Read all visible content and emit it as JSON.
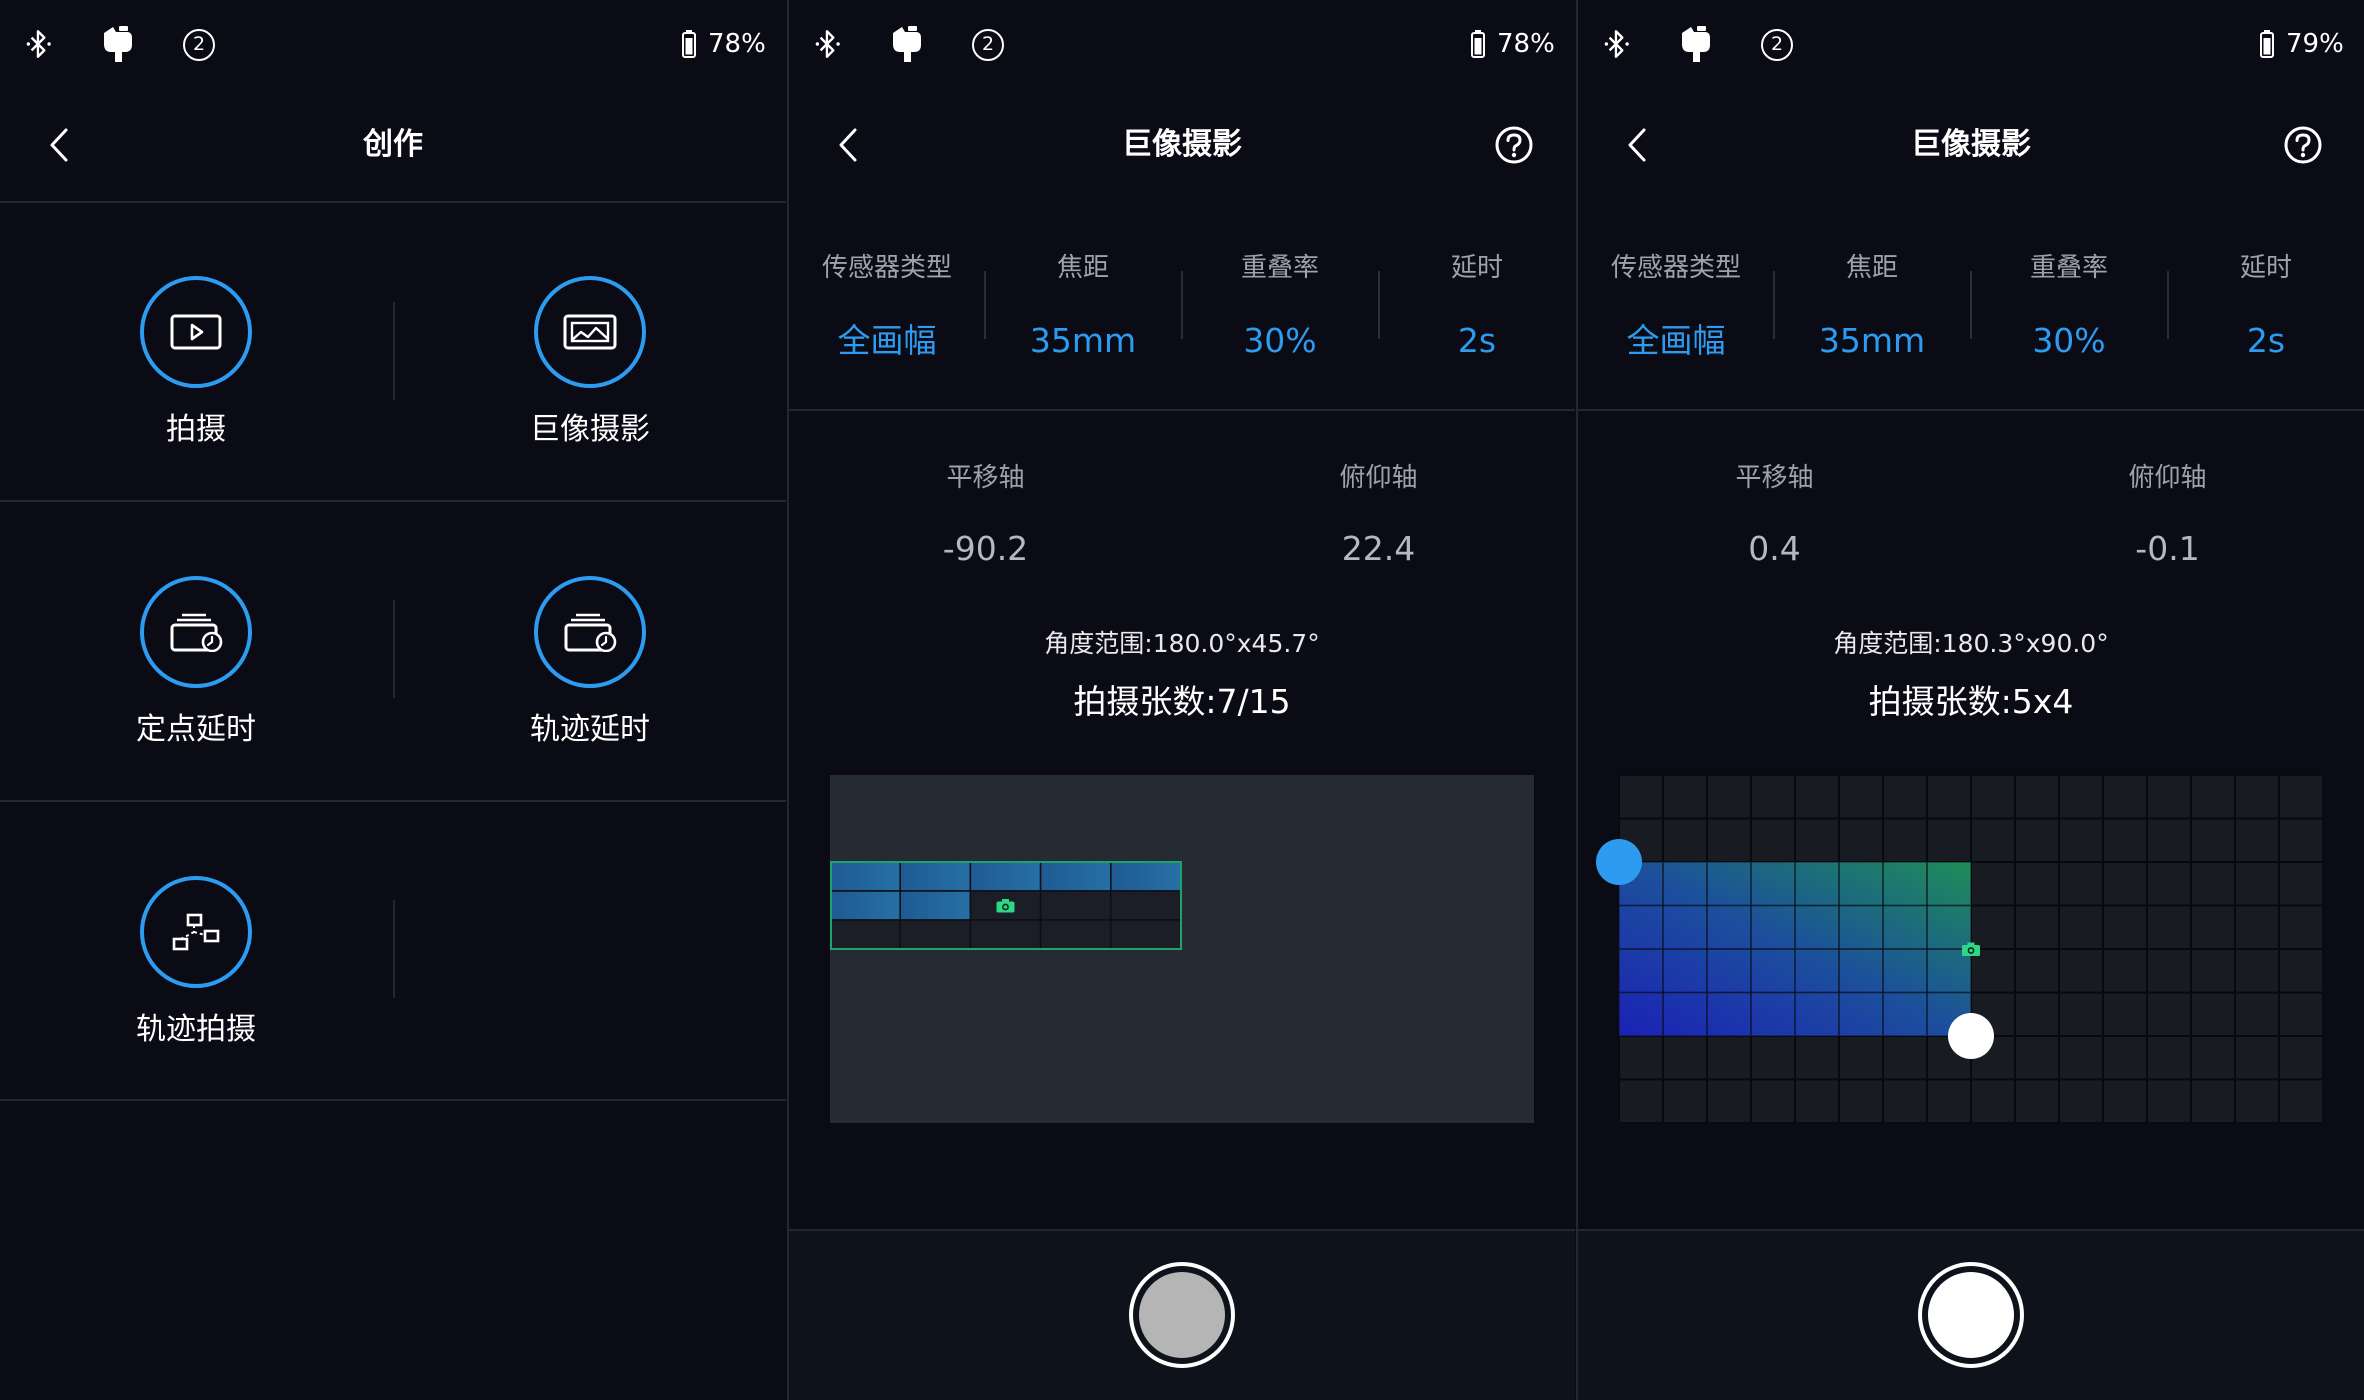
{
  "colors": {
    "background": "#0a0b14",
    "accent": "#2d9cf0",
    "captured_cell": "#22629c",
    "progress_border": "#1fa36b",
    "camera_marker": "#2ed685",
    "range_start_handle": "#2d9cf0",
    "range_end_handle": "#ffffff"
  },
  "status_bars": [
    {
      "badge": "2",
      "battery": "78%",
      "icons": [
        "bluetooth-icon",
        "gimbal-icon",
        "battery-icon"
      ]
    },
    {
      "badge": "2",
      "battery": "78%",
      "icons": [
        "bluetooth-icon",
        "gimbal-icon",
        "battery-icon"
      ]
    },
    {
      "badge": "2",
      "battery": "79%",
      "icons": [
        "bluetooth-icon",
        "gimbal-icon",
        "battery-icon"
      ]
    }
  ],
  "creation": {
    "title": "创作",
    "menu": [
      {
        "label": "拍摄",
        "icon": "video-icon"
      },
      {
        "label": "巨像摄影",
        "icon": "panorama-icon"
      },
      {
        "label": "定点延时",
        "icon": "timelapse-icon"
      },
      {
        "label": "轨迹延时",
        "icon": "timelapse-icon"
      },
      {
        "label": "轨迹拍摄",
        "icon": "path-icon"
      }
    ]
  },
  "panorama_a": {
    "title": "巨像摄影",
    "params": [
      {
        "label": "传感器类型",
        "value": "全画幅"
      },
      {
        "label": "焦距",
        "value": "35mm"
      },
      {
        "label": "重叠率",
        "value": "30%"
      },
      {
        "label": "延时",
        "value": "2s"
      }
    ],
    "axes": [
      {
        "label": "平移轴",
        "value": "-90.2"
      },
      {
        "label": "俯仰轴",
        "value": "22.4"
      }
    ],
    "angle_range": "角度范围:180.0°x45.7°",
    "shot_count": "拍摄张数:7/15",
    "captured": 7,
    "shutter_fill": "#b5b5b5"
  },
  "panorama_b": {
    "title": "巨像摄影",
    "params": [
      {
        "label": "传感器类型",
        "value": "全画幅"
      },
      {
        "label": "焦距",
        "value": "35mm"
      },
      {
        "label": "重叠率",
        "value": "30%"
      },
      {
        "label": "延时",
        "value": "2s"
      }
    ],
    "axes": [
      {
        "label": "平移轴",
        "value": "0.4"
      },
      {
        "label": "俯仰轴",
        "value": "-0.1"
      }
    ],
    "angle_range": "角度范围:180.3°x90.0°",
    "shot_count": "拍摄张数:5x4",
    "shutter_fill": "#ffffff"
  }
}
